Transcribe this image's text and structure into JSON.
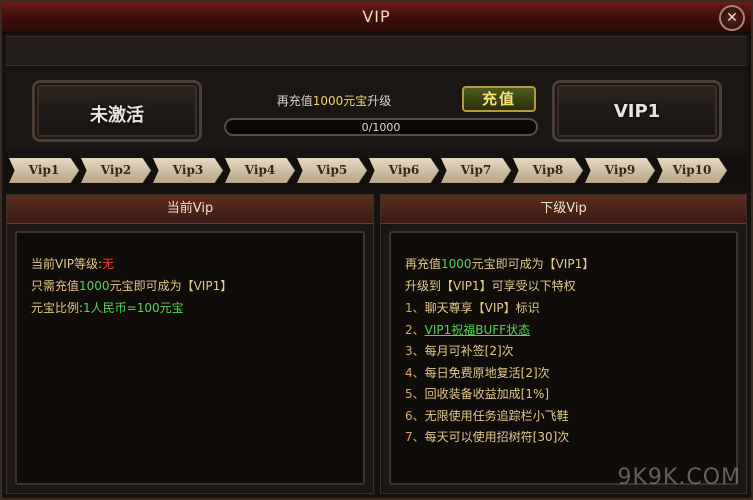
{
  "window": {
    "title": "VIP",
    "close": "✕"
  },
  "current": {
    "status_label": "未激活",
    "next_label": "VIP1"
  },
  "recharge": {
    "text_prefix": "再充值",
    "amount": "1000元宝",
    "text_suffix": "升级",
    "progress_text": "0/1000",
    "progress_fraction": 0,
    "button_label": "充值"
  },
  "tabs": [
    "Vip1",
    "Vip2",
    "Vip3",
    "Vip4",
    "Vip5",
    "Vip6",
    "Vip7",
    "Vip8",
    "Vip9",
    "Vip10"
  ],
  "left_panel": {
    "header": "当前Vip",
    "level_label": "当前VIP等级:",
    "level_value": "无",
    "need_prefix": "只需充值",
    "need_amount": "1000",
    "need_mid": "元宝即可成为",
    "need_vip": "【VIP1】",
    "ratio_label": "元宝比例:",
    "ratio_value": "1人民币=100元宝"
  },
  "right_panel": {
    "header": "下级Vip",
    "line1_prefix": "再充值",
    "line1_amount": "1000",
    "line1_mid": "元宝即可成为",
    "line1_vip": "【VIP1】",
    "line2": "升级到【VIP1】可享受以下特权",
    "items": [
      {
        "num": "1、",
        "text": "聊天尊享【VIP】标识"
      },
      {
        "num": "2、",
        "text": "VIP1祝福BUFF状态"
      },
      {
        "num": "3、",
        "text": "每月可补签[2]次"
      },
      {
        "num": "4、",
        "text": "每日免费原地复活[2]次"
      },
      {
        "num": "5、",
        "text": "回收装备收益加成[1%]"
      },
      {
        "num": "6、",
        "text": "无限使用任务追踪栏小飞鞋"
      },
      {
        "num": "7、",
        "text": "每天可以使用招树符[30]次"
      }
    ]
  },
  "watermark": "9K9K.COM",
  "colors": {
    "accent_gold": "#f3d160",
    "value_green": "#5ad25a",
    "value_red": "#ff3a2a"
  }
}
